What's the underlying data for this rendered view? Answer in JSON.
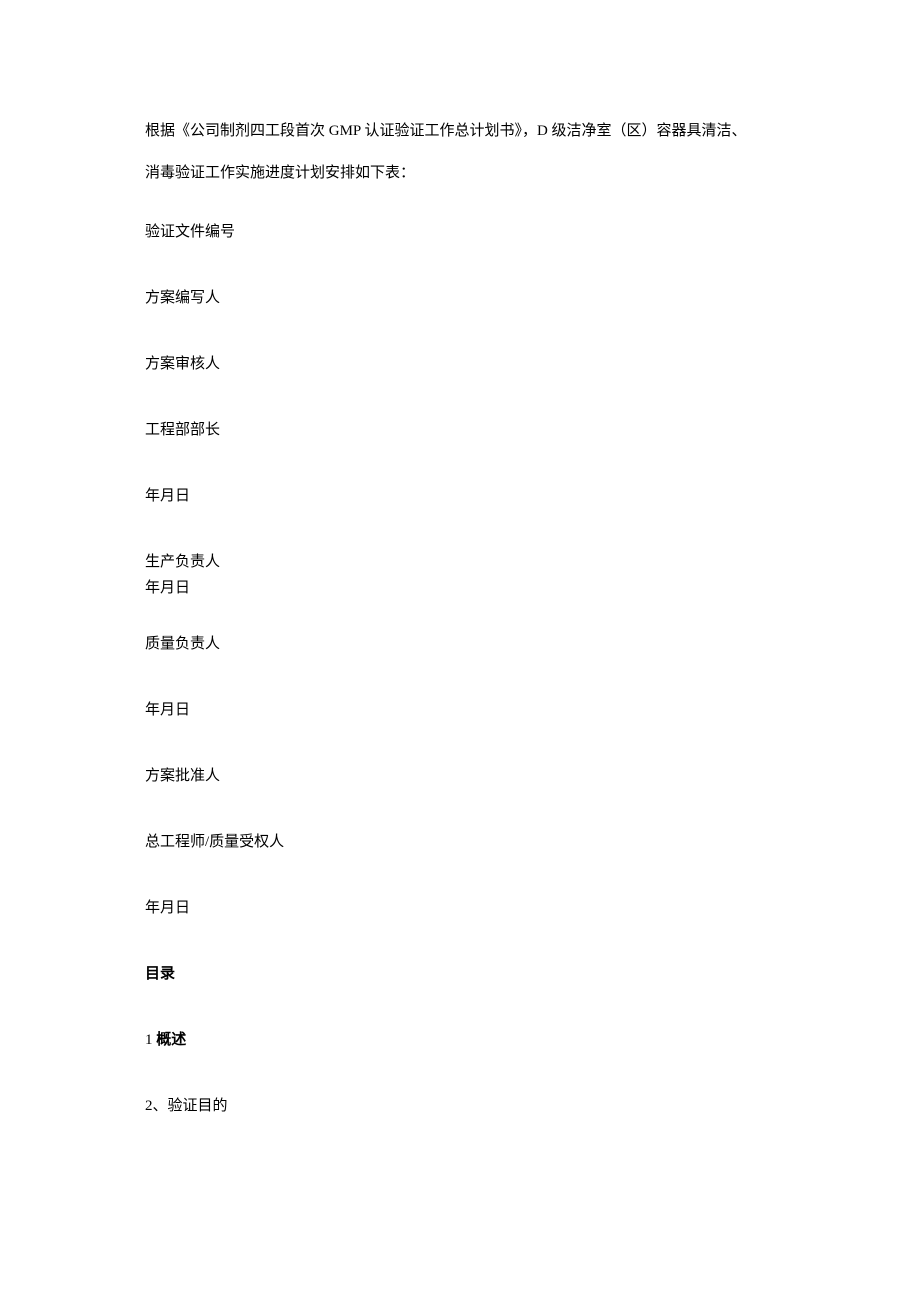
{
  "intro": {
    "line1": "根据《公司制剂四工段首次 GMP 认证验证工作总计划书》，D 级洁净室（区）容器具清洁、",
    "line2": "消毒验证工作实施进度计划安排如下表："
  },
  "fields": {
    "doc_number": "验证文件编号",
    "plan_writer": "方案编写人",
    "plan_reviewer": "方案审核人",
    "engineering_head": "工程部部长",
    "date1": "年月日",
    "production_head": "生产负责人",
    "date2": "年月日",
    "quality_head": "质量负责人",
    "date3": "年月日",
    "plan_approver": "方案批准人",
    "chief_engineer": "总工程师/质量受权人",
    "date4": "年月日"
  },
  "toc": {
    "heading": "目录",
    "item1_num": "1 ",
    "item1_text": "概述",
    "item2": "2、验证目的"
  }
}
